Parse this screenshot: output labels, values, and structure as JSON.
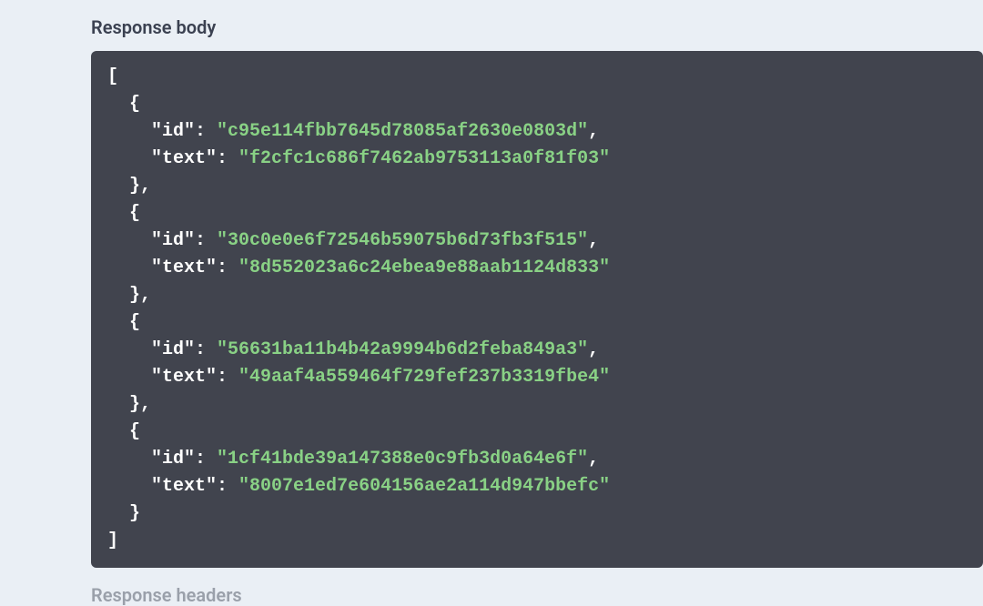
{
  "sections": {
    "respBodyTitle": "Response body",
    "respHeadersTitle": "Response headers"
  },
  "responseBody": [
    {
      "id": "c95e114fbb7645d78085af2630e0803d",
      "text": "f2cfc1c686f7462ab9753113a0f81f03"
    },
    {
      "id": "30c0e0e6f72546b59075b6d73fb3f515",
      "text": "8d552023a6c24ebea9e88aab1124d833"
    },
    {
      "id": "56631ba11b4b42a9994b6d2feba849a3",
      "text": "49aaf4a559464f729fef237b3319fbe4"
    },
    {
      "id": "1cf41bde39a147388e0c9fb3d0a64e6f",
      "text": "8007e1ed7e604156ae2a114d947bbefc"
    }
  ]
}
